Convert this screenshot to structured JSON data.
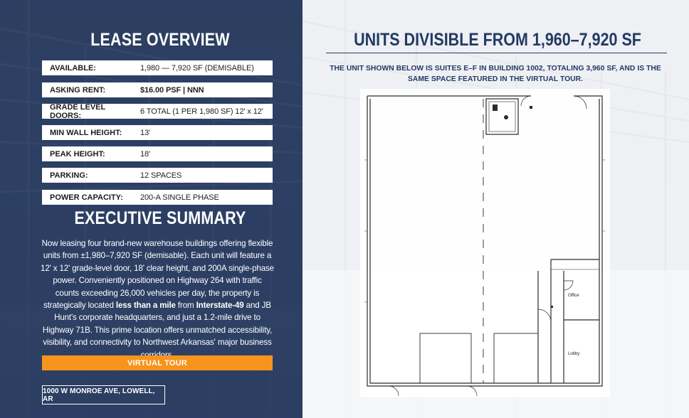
{
  "lease": {
    "title": "LEASE OVERVIEW",
    "rows": [
      {
        "label": "AVAILABLE:",
        "value": "1,980 — 7,920 SF (DEMISABLE)",
        "bold": false
      },
      {
        "label": "ASKING RENT:",
        "value": "$16.00 PSF | NNN",
        "bold": true
      },
      {
        "label": "GRADE LEVEL DOORS:",
        "value": "6 TOTAL (1 PER 1,980 SF) 12' x 12'",
        "bold": false
      },
      {
        "label": "MIN WALL HEIGHT:",
        "value": "13'",
        "bold": false
      },
      {
        "label": "PEAK HEIGHT:",
        "value": "18'",
        "bold": false
      },
      {
        "label": "PARKING:",
        "value": "12 SPACES",
        "bold": false
      },
      {
        "label": "POWER CAPACITY:",
        "value": "200-A SINGLE PHASE",
        "bold": false
      }
    ]
  },
  "summary": {
    "title": "EXECUTIVE SUMMARY",
    "text_1": "Now leasing four brand-new warehouse buildings offering flexible units from ±1,980–7,920 SF (demisable). Each unit will feature a 12' x 12' grade-level door, 18' clear height, and 200A single-phase power. Conveniently positioned on Highway 264 with traffic counts exceeding 26,000 vehicles per day, the property is strategically located ",
    "bold_1": "less than a mile",
    "text_2": " from ",
    "bold_2": "Interstate-49",
    "text_3": " and JB Hunt's corporate headquarters, and just a 1.2-mile drive to Highway 71B. This prime location offers unmatched accessibility, visibility, and connectivity to Northwest Arkansas' major business corridors."
  },
  "virtual_tour_label": "VIRTUAL TOUR",
  "address": "1000 W MONROE AVE, LOWELL, AR",
  "units": {
    "title": "UNITS DIVISIBLE FROM 1,960–7,920 SF",
    "subtitle": "THE UNIT SHOWN BELOW IS SUITES E–F IN BUILDING 1002, TOTALING 3,960 SF, AND IS THE SAME SPACE FEATURED IN THE VIRTUAL TOUR."
  },
  "floorplan": {
    "room_office": "Office",
    "room_lobby": "Lobby"
  },
  "colors": {
    "navy": "#233a63",
    "orange": "#f7941d"
  }
}
